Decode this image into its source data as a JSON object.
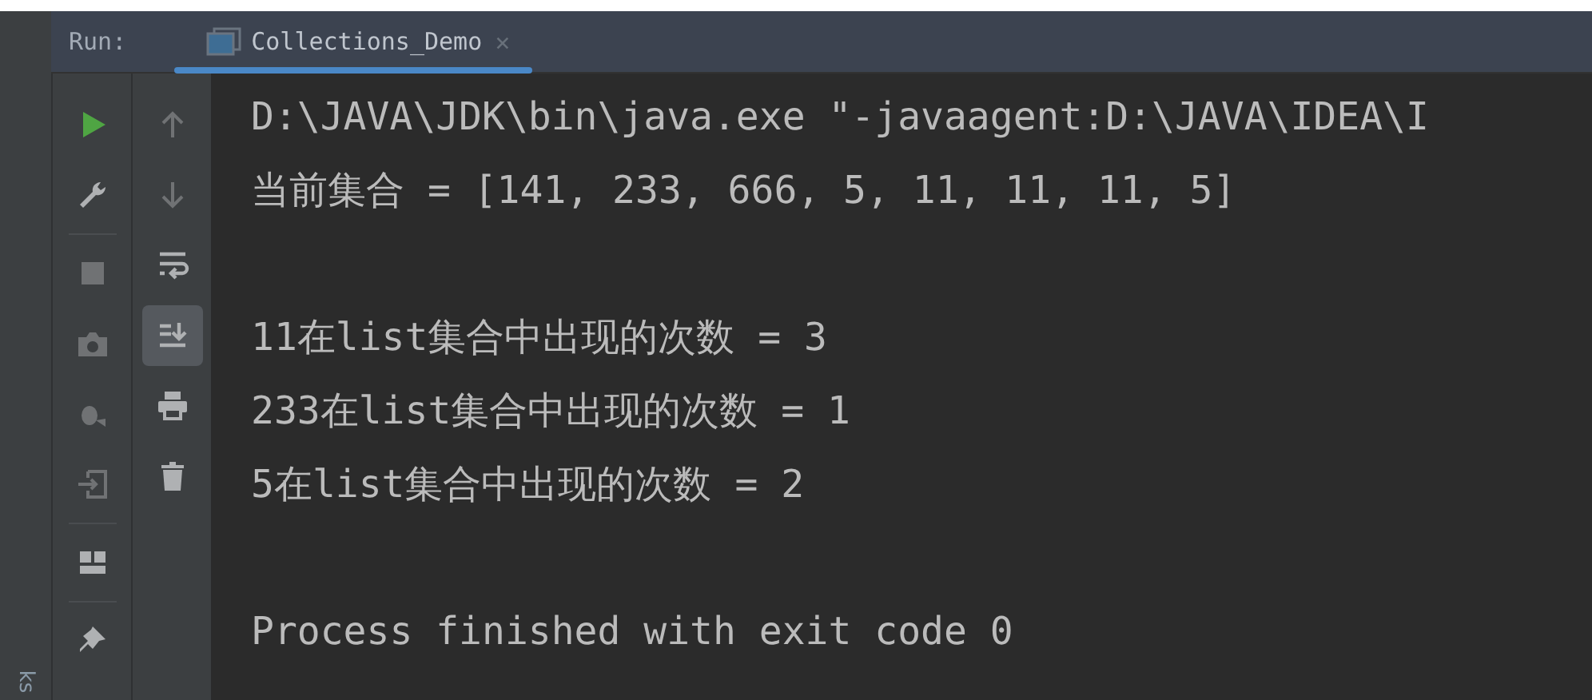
{
  "run_bar": {
    "label": "Run:",
    "tabs": [
      {
        "title": "Collections_Demo",
        "close": "×",
        "selected": true
      }
    ]
  },
  "side_tab": {
    "label": "ks"
  },
  "left_toolbar": [
    {
      "disabled": false
    },
    {
      "disabled": false
    },
    {
      "disabled": true
    },
    {
      "disabled": true
    },
    {
      "disabled": true
    },
    {
      "disabled": true
    },
    {
      "disabled": false
    },
    {
      "disabled": false
    }
  ],
  "right_toolbar": [
    {
      "disabled": true,
      "on": false
    },
    {
      "disabled": true,
      "on": false
    },
    {
      "disabled": false,
      "on": false
    },
    {
      "disabled": false,
      "on": true
    },
    {
      "disabled": false,
      "on": false
    },
    {
      "disabled": false,
      "on": false
    }
  ],
  "console": {
    "groups": [
      [
        "D:\\JAVA\\JDK\\bin\\java.exe \"-javaagent:D:\\JAVA\\IDEA\\I",
        "当前集合 = [141, 233, 666, 5, 11, 11, 11, 5]"
      ],
      [
        "11在list集合中出现的次数 = 3",
        "233在list集合中出现的次数 = 1",
        "5在list集合中出现的次数 = 2"
      ],
      [
        "Process finished with exit code 0"
      ]
    ]
  }
}
